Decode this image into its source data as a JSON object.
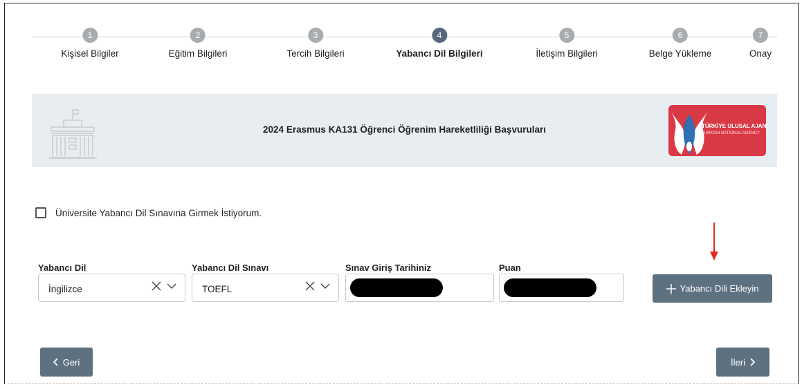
{
  "stepper": {
    "steps": [
      {
        "number": "1",
        "label": "Kişisel Bilgiler",
        "active": false
      },
      {
        "number": "2",
        "label": "Eğitim Bilgileri",
        "active": false
      },
      {
        "number": "3",
        "label": "Tercih Bilgileri",
        "active": false
      },
      {
        "number": "4",
        "label": "Yabancı Dil Bilgileri",
        "active": true
      },
      {
        "number": "5",
        "label": "İletişim Bilgileri",
        "active": false
      },
      {
        "number": "6",
        "label": "Belge Yükleme",
        "active": false
      },
      {
        "number": "7",
        "label": "Onay",
        "active": false
      }
    ]
  },
  "banner": {
    "title": "2024 Erasmus KA131 Öğrenci Öğrenim Hareketliliği Başvuruları",
    "logo_text_main": "TÜRKİYE ULUSAL AJANSI",
    "logo_text_sub": "TURKISH NATIONAL AGENCY"
  },
  "exam_checkbox": {
    "label": "Üniversite Yabancı Dil Sınavına Girmek İstiyorum.",
    "checked": false
  },
  "form": {
    "language_label": "Yabancı Dil",
    "language_value": "İngilizce",
    "exam_label": "Yabancı Dil Sınavı",
    "exam_value": "TOEFL",
    "date_label": "Sınav Giriş Tarihiniz",
    "score_label": "Puan",
    "add_button_label": "Yabancı Dili Ekleyin"
  },
  "navigation": {
    "back_label": "Geri",
    "next_label": "İleri"
  },
  "colors": {
    "accent": "#5e7181",
    "active_step": "#56687a",
    "inactive_step": "#a9acae",
    "banner_bg": "#e8edf2",
    "logo_red": "#d93945",
    "arrow_red": "#e32b1c"
  }
}
